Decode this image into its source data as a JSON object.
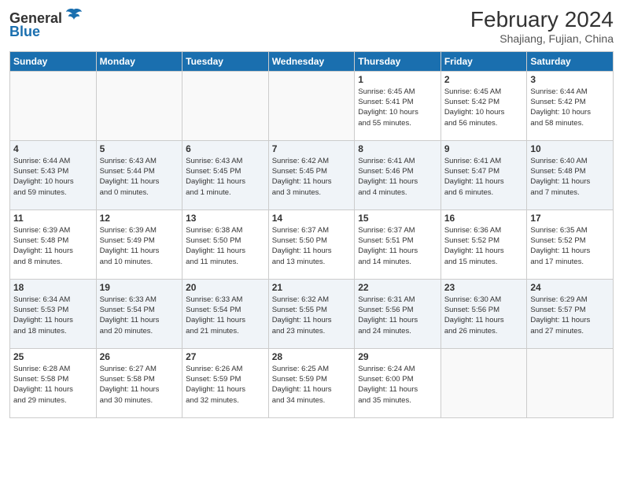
{
  "logo": {
    "general": "General",
    "blue": "Blue"
  },
  "header": {
    "month_year": "February 2024",
    "location": "Shajiang, Fujian, China"
  },
  "weekdays": [
    "Sunday",
    "Monday",
    "Tuesday",
    "Wednesday",
    "Thursday",
    "Friday",
    "Saturday"
  ],
  "weeks": [
    [
      {
        "day": "",
        "info": ""
      },
      {
        "day": "",
        "info": ""
      },
      {
        "day": "",
        "info": ""
      },
      {
        "day": "",
        "info": ""
      },
      {
        "day": "1",
        "info": "Sunrise: 6:45 AM\nSunset: 5:41 PM\nDaylight: 10 hours\nand 55 minutes."
      },
      {
        "day": "2",
        "info": "Sunrise: 6:45 AM\nSunset: 5:42 PM\nDaylight: 10 hours\nand 56 minutes."
      },
      {
        "day": "3",
        "info": "Sunrise: 6:44 AM\nSunset: 5:42 PM\nDaylight: 10 hours\nand 58 minutes."
      }
    ],
    [
      {
        "day": "4",
        "info": "Sunrise: 6:44 AM\nSunset: 5:43 PM\nDaylight: 10 hours\nand 59 minutes."
      },
      {
        "day": "5",
        "info": "Sunrise: 6:43 AM\nSunset: 5:44 PM\nDaylight: 11 hours\nand 0 minutes."
      },
      {
        "day": "6",
        "info": "Sunrise: 6:43 AM\nSunset: 5:45 PM\nDaylight: 11 hours\nand 1 minute."
      },
      {
        "day": "7",
        "info": "Sunrise: 6:42 AM\nSunset: 5:45 PM\nDaylight: 11 hours\nand 3 minutes."
      },
      {
        "day": "8",
        "info": "Sunrise: 6:41 AM\nSunset: 5:46 PM\nDaylight: 11 hours\nand 4 minutes."
      },
      {
        "day": "9",
        "info": "Sunrise: 6:41 AM\nSunset: 5:47 PM\nDaylight: 11 hours\nand 6 minutes."
      },
      {
        "day": "10",
        "info": "Sunrise: 6:40 AM\nSunset: 5:48 PM\nDaylight: 11 hours\nand 7 minutes."
      }
    ],
    [
      {
        "day": "11",
        "info": "Sunrise: 6:39 AM\nSunset: 5:48 PM\nDaylight: 11 hours\nand 8 minutes."
      },
      {
        "day": "12",
        "info": "Sunrise: 6:39 AM\nSunset: 5:49 PM\nDaylight: 11 hours\nand 10 minutes."
      },
      {
        "day": "13",
        "info": "Sunrise: 6:38 AM\nSunset: 5:50 PM\nDaylight: 11 hours\nand 11 minutes."
      },
      {
        "day": "14",
        "info": "Sunrise: 6:37 AM\nSunset: 5:50 PM\nDaylight: 11 hours\nand 13 minutes."
      },
      {
        "day": "15",
        "info": "Sunrise: 6:37 AM\nSunset: 5:51 PM\nDaylight: 11 hours\nand 14 minutes."
      },
      {
        "day": "16",
        "info": "Sunrise: 6:36 AM\nSunset: 5:52 PM\nDaylight: 11 hours\nand 15 minutes."
      },
      {
        "day": "17",
        "info": "Sunrise: 6:35 AM\nSunset: 5:52 PM\nDaylight: 11 hours\nand 17 minutes."
      }
    ],
    [
      {
        "day": "18",
        "info": "Sunrise: 6:34 AM\nSunset: 5:53 PM\nDaylight: 11 hours\nand 18 minutes."
      },
      {
        "day": "19",
        "info": "Sunrise: 6:33 AM\nSunset: 5:54 PM\nDaylight: 11 hours\nand 20 minutes."
      },
      {
        "day": "20",
        "info": "Sunrise: 6:33 AM\nSunset: 5:54 PM\nDaylight: 11 hours\nand 21 minutes."
      },
      {
        "day": "21",
        "info": "Sunrise: 6:32 AM\nSunset: 5:55 PM\nDaylight: 11 hours\nand 23 minutes."
      },
      {
        "day": "22",
        "info": "Sunrise: 6:31 AM\nSunset: 5:56 PM\nDaylight: 11 hours\nand 24 minutes."
      },
      {
        "day": "23",
        "info": "Sunrise: 6:30 AM\nSunset: 5:56 PM\nDaylight: 11 hours\nand 26 minutes."
      },
      {
        "day": "24",
        "info": "Sunrise: 6:29 AM\nSunset: 5:57 PM\nDaylight: 11 hours\nand 27 minutes."
      }
    ],
    [
      {
        "day": "25",
        "info": "Sunrise: 6:28 AM\nSunset: 5:58 PM\nDaylight: 11 hours\nand 29 minutes."
      },
      {
        "day": "26",
        "info": "Sunrise: 6:27 AM\nSunset: 5:58 PM\nDaylight: 11 hours\nand 30 minutes."
      },
      {
        "day": "27",
        "info": "Sunrise: 6:26 AM\nSunset: 5:59 PM\nDaylight: 11 hours\nand 32 minutes."
      },
      {
        "day": "28",
        "info": "Sunrise: 6:25 AM\nSunset: 5:59 PM\nDaylight: 11 hours\nand 34 minutes."
      },
      {
        "day": "29",
        "info": "Sunrise: 6:24 AM\nSunset: 6:00 PM\nDaylight: 11 hours\nand 35 minutes."
      },
      {
        "day": "",
        "info": ""
      },
      {
        "day": "",
        "info": ""
      }
    ]
  ]
}
